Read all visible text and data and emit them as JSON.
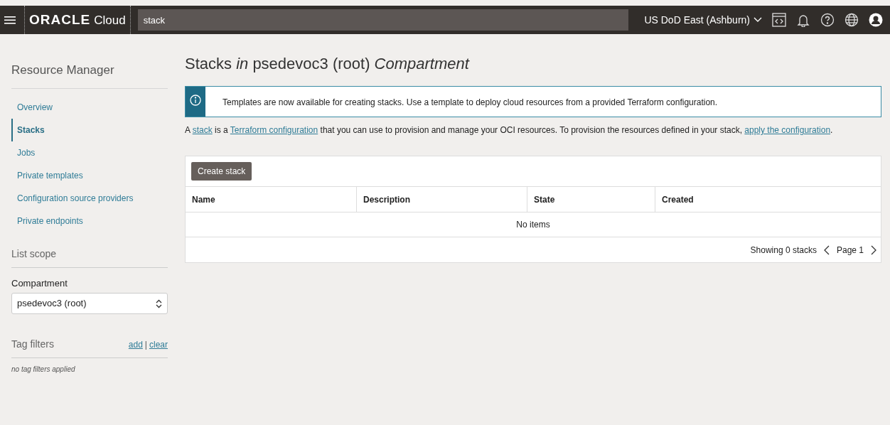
{
  "header": {
    "logo": "ORACLE",
    "logo_suffix": "Cloud",
    "search": {
      "value": "stack"
    },
    "region": "US DoD East (Ashburn)"
  },
  "sidebar": {
    "title": "Resource Manager",
    "items": [
      {
        "label": "Overview",
        "selected": false
      },
      {
        "label": "Stacks",
        "selected": true
      },
      {
        "label": "Jobs",
        "selected": false
      },
      {
        "label": "Private templates",
        "selected": false
      },
      {
        "label": "Configuration source providers",
        "selected": false
      },
      {
        "label": "Private endpoints",
        "selected": false
      }
    ],
    "list_scope": {
      "title": "List scope",
      "field_label": "Compartment",
      "value": "psedevoc3 (root)"
    },
    "tag_filters": {
      "title": "Tag filters",
      "add": "add",
      "separator": "|",
      "clear": "clear",
      "empty": "no tag filters applied"
    }
  },
  "main": {
    "title": "Stacks *in* psedevoc3 (root) *Compartment*",
    "banner": "Templates are now available for creating stacks. Use a template to deploy cloud resources from a provided Terraform configuration.",
    "description": [
      {
        "kind": "text",
        "text": "A "
      },
      {
        "kind": "link",
        "text": "stack"
      },
      {
        "kind": "text",
        "text": " is a "
      },
      {
        "kind": "link",
        "text": "Terraform configuration"
      },
      {
        "kind": "text",
        "text": " that you can use to provision and manage your OCI resources. To provision the resources defined in your stack, "
      },
      {
        "kind": "link",
        "text": "apply the configuration"
      },
      {
        "kind": "text",
        "text": "."
      }
    ],
    "create_button": "Create stack",
    "table": {
      "columns": [
        "Name",
        "Description",
        "State",
        "Created"
      ],
      "empty": "No items",
      "summary": "Showing 0 stacks",
      "page": "Page 1"
    }
  }
}
